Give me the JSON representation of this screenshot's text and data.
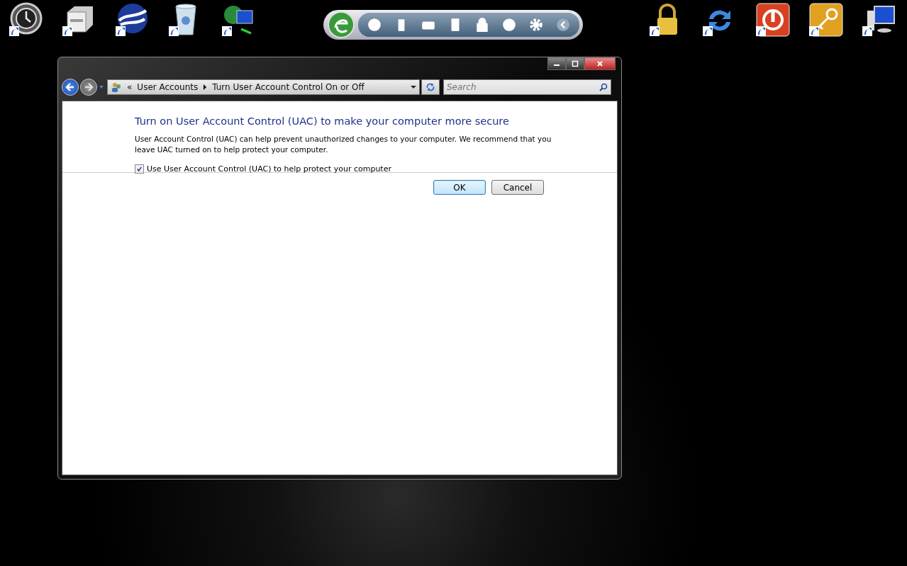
{
  "address_bar": {
    "overflow": "«",
    "breadcrumbs": [
      "User Accounts",
      "Turn User Account Control On or Off"
    ]
  },
  "search": {
    "placeholder": "Search"
  },
  "content": {
    "heading": "Turn on User Account Control (UAC) to make your computer more secure",
    "description": "User Account Control (UAC) can help prevent unauthorized changes to your computer.  We recommend that you leave UAC turned on to help protect your computer.",
    "checkbox": {
      "label": "Use User Account Control (UAC) to help protect your computer",
      "checked": true
    }
  },
  "buttons": [
    {
      "label": "OK",
      "default": true
    },
    {
      "label": "Cancel",
      "default": false
    }
  ]
}
